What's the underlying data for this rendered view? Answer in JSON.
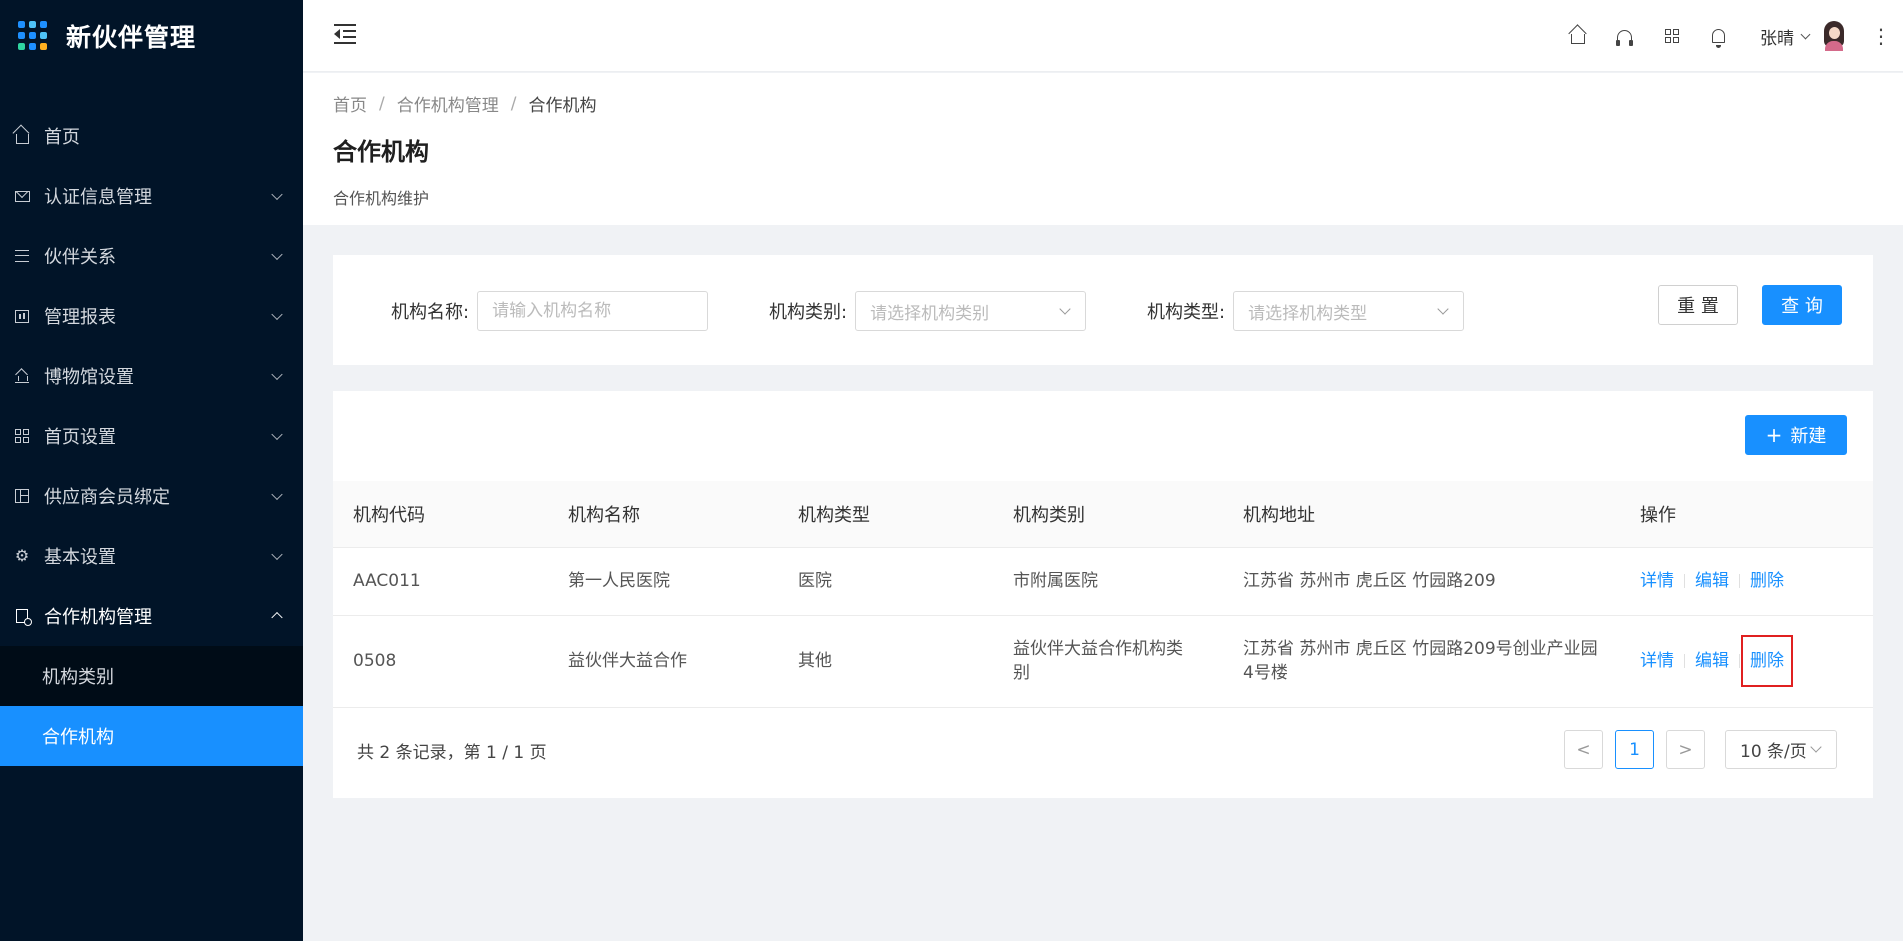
{
  "app": {
    "title": "新伙伴管理"
  },
  "sidebar": {
    "items": [
      {
        "label": "首页",
        "icon": "home-icon"
      },
      {
        "label": "认证信息管理",
        "icon": "mail-icon"
      },
      {
        "label": "伙伴关系",
        "icon": "list-icon"
      },
      {
        "label": "管理报表",
        "icon": "chart-board-icon"
      },
      {
        "label": "博物馆设置",
        "icon": "bank-icon"
      },
      {
        "label": "首页设置",
        "icon": "apps-icon"
      },
      {
        "label": "供应商会员绑定",
        "icon": "layout-icon"
      },
      {
        "label": "基本设置",
        "icon": "gear-icon"
      },
      {
        "label": "合作机构管理",
        "icon": "document-icon"
      }
    ],
    "submenu": [
      {
        "label": "机构类别"
      },
      {
        "label": "合作机构"
      }
    ]
  },
  "header": {
    "user_name": "张晴",
    "icons": [
      "home-icon",
      "headset-icon",
      "grid-icon",
      "bell-icon"
    ],
    "more": "⋮"
  },
  "breadcrumb": {
    "items": [
      "首页",
      "合作机构管理",
      "合作机构"
    ],
    "separator": "/"
  },
  "page": {
    "title": "合作机构",
    "description": "合作机构维护"
  },
  "search": {
    "name_label": "机构名称:",
    "name_placeholder": "请输入机构名称",
    "category_label": "机构类别:",
    "category_placeholder": "请选择机构类别",
    "type_label": "机构类型:",
    "type_placeholder": "请选择机构类型",
    "reset_label": "重 置",
    "query_label": "查 询"
  },
  "table": {
    "new_label": "新建",
    "columns": [
      "机构代码",
      "机构名称",
      "机构类型",
      "机构类别",
      "机构地址",
      "操作"
    ],
    "rows": [
      {
        "code": "AAC011",
        "name": "第一人民医院",
        "type": "医院",
        "category": "市附属医院",
        "address": "江苏省 苏州市 虎丘区 竹园路209"
      },
      {
        "code": "0508",
        "name": "益伙伴大益合作",
        "type": "其他",
        "category": "益伙伴大益合作机构类别",
        "address": "江苏省 苏州市 虎丘区 竹园路209号创业产业园4号楼"
      }
    ],
    "actions": {
      "detail": "详情",
      "edit": "编辑",
      "delete": "删除"
    }
  },
  "pagination": {
    "summary": "共 2 条记录，第 1 / 1 页",
    "prev": "<",
    "current": "1",
    "next": ">",
    "page_size": "10 条/页"
  },
  "colors": {
    "sidebar_bg": "#011428",
    "primary": "#1890ff",
    "highlight": "#e02020"
  }
}
